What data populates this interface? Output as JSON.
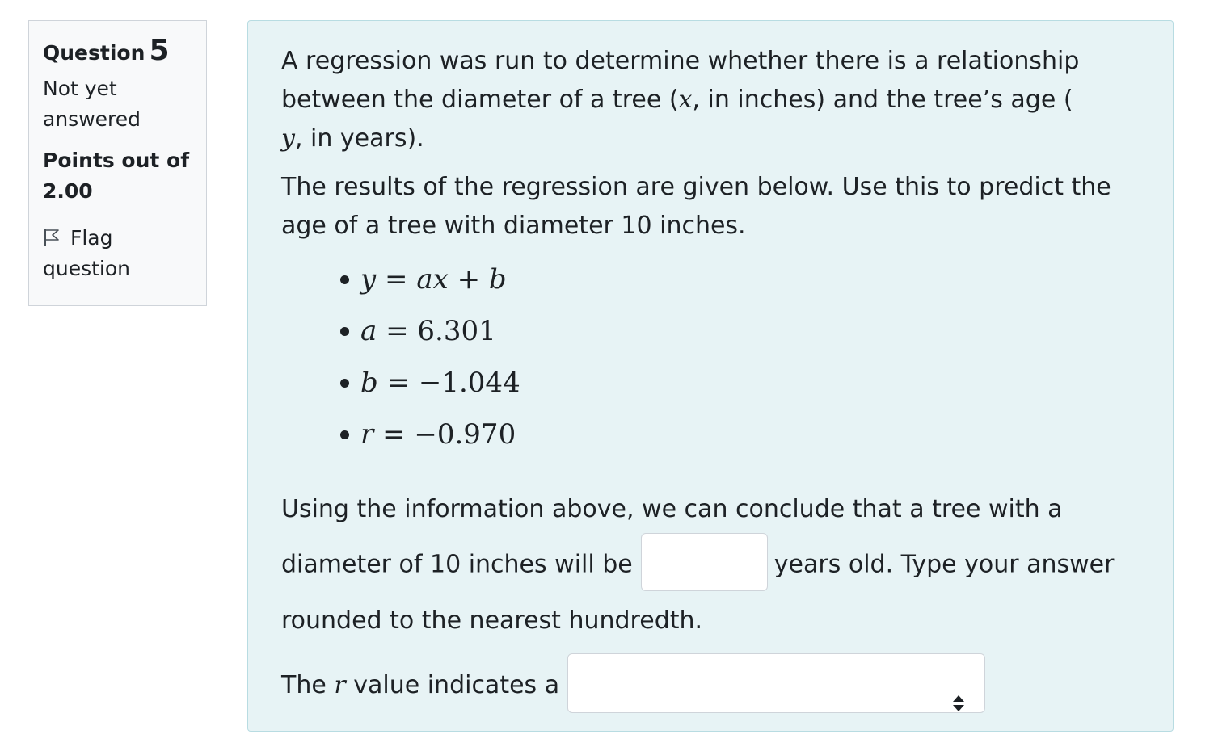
{
  "info": {
    "question_label": "Question",
    "question_number": "5",
    "state_line1": "Not yet",
    "state_line2": "answered",
    "grade_line1": "Points out of",
    "grade_line2": "2.00",
    "flag_line1": "Flag",
    "flag_line2": "question",
    "flag_icon": "flag-outline-icon"
  },
  "question": {
    "p1_a": "A regression was run to determine whether there is a relationship between the diameter of a tree (",
    "p1_x": "x",
    "p1_b": ", in inches) and the tree’s age (",
    "p1_y": "y",
    "p1_c": ", in years).",
    "p2": "The results of the regression are given below. Use this to predict the age of a tree with diameter 10 inches.",
    "facts": [
      {
        "lhs": "y",
        "eq": " = ",
        "rhs_italic": "ax",
        "plus": " + ",
        "rhs2": "b"
      },
      {
        "lhs": "a",
        "eq": " = ",
        "value": "6.301"
      },
      {
        "lhs": "b",
        "eq": " = ",
        "value": "−1.044"
      },
      {
        "lhs": "r",
        "eq": " = ",
        "value": "−0.970"
      }
    ],
    "answer_a": "Using the information above, we can conclude that a tree with a diameter of 10 inches will be",
    "answer_b": "years old. Type your answer rounded to the nearest hundredth.",
    "answer_value": "",
    "select_a": "The",
    "select_r": "r",
    "select_b": "value indicates a",
    "select_value": "",
    "select_icon": "up-down-arrows-icon"
  }
}
